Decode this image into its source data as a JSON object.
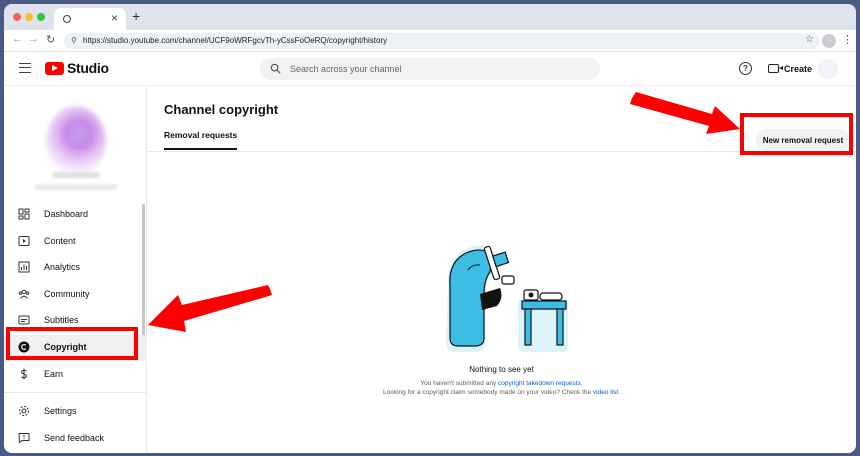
{
  "browser": {
    "tab_close": "×",
    "new_tab": "+",
    "nav": {
      "back": "←",
      "forward": "→",
      "reload": "↻"
    },
    "url": "https://studio.youtube.com/channel/UCF9oWRFgcvTh-yCssFoOeRQ/copyright/history"
  },
  "header": {
    "logo_text": "Studio",
    "search_placeholder": "Search across your channel",
    "help_glyph": "?",
    "create_label": "Create"
  },
  "sidebar": {
    "items": [
      {
        "label": "Dashboard",
        "icon": "dashboard-icon"
      },
      {
        "label": "Content",
        "icon": "content-icon"
      },
      {
        "label": "Analytics",
        "icon": "analytics-icon"
      },
      {
        "label": "Community",
        "icon": "community-icon"
      },
      {
        "label": "Subtitles",
        "icon": "subtitles-icon"
      },
      {
        "label": "Copyright",
        "icon": "copyright-icon",
        "active": true
      },
      {
        "label": "Earn",
        "icon": "earn-icon"
      },
      {
        "label": "Settings",
        "icon": "settings-icon"
      },
      {
        "label": "Send feedback",
        "icon": "feedback-icon"
      }
    ]
  },
  "main": {
    "title": "Channel copyright",
    "tab": "Removal requests",
    "new_request_button": "New removal request",
    "empty_state": {
      "title": "Nothing to see yet",
      "line1_prefix": "You haven't submitted any ",
      "line1_link": "copyright takedown requests",
      "line1_suffix": ".",
      "line2_prefix": "Looking for a copyright claim somebody made on your video? Check the ",
      "line2_link": "video list",
      "line2_suffix": "."
    }
  },
  "colors": {
    "annotation": "#ff0000",
    "youtube_red": "#ff0000",
    "link": "#065fd4",
    "illustration_cyan": "#3bbde4"
  }
}
